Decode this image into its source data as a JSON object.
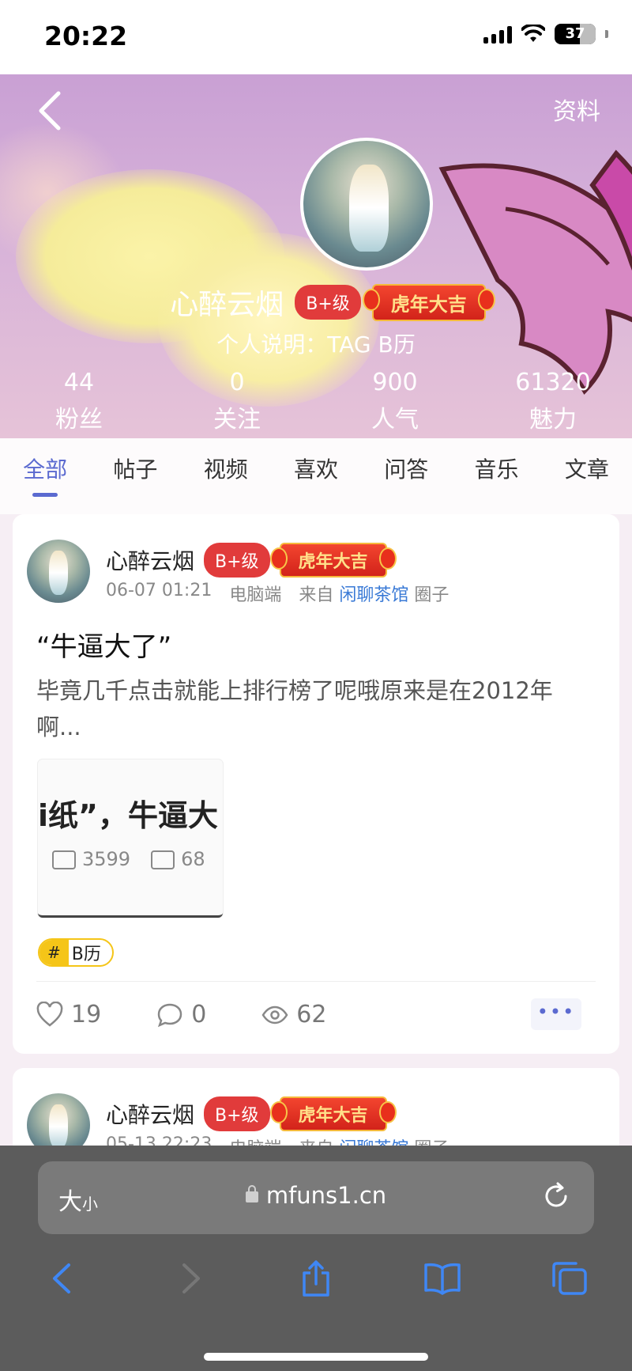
{
  "status_bar": {
    "time": "20:22",
    "battery": "37"
  },
  "header": {
    "profile_link": "资料"
  },
  "profile": {
    "name": "心醉云烟",
    "level": "B+级",
    "festive_badge": "虎年大吉",
    "bio": "个人说明：TAG B历",
    "stats": [
      {
        "value": "44",
        "label": "粉丝"
      },
      {
        "value": "0",
        "label": "关注"
      },
      {
        "value": "900",
        "label": "人气"
      },
      {
        "value": "61320",
        "label": "魅力"
      }
    ]
  },
  "tabs": [
    {
      "label": "全部",
      "active": true
    },
    {
      "label": "帖子"
    },
    {
      "label": "视频"
    },
    {
      "label": "喜欢"
    },
    {
      "label": "问答"
    },
    {
      "label": "音乐"
    },
    {
      "label": "文章"
    }
  ],
  "posts": [
    {
      "author": "心醉云烟",
      "level": "B+级",
      "festive_badge": "虎年大吉",
      "date": "06-07 01:21",
      "device": "电脑端",
      "from_label": "来自",
      "circle": "闲聊茶馆",
      "circle_suffix": "圈子",
      "title": "“牛逼大了”",
      "body": "毕竟几千点击就能上排行榜了呢哦原来是在2012年啊...",
      "thumbnail": {
        "text": "i纸”，牛逼大",
        "plays": "3599",
        "comments": "68"
      },
      "tag": {
        "hash": "#",
        "label": "B历"
      },
      "likes": "19",
      "comments": "0",
      "views": "62",
      "more": "•••"
    },
    {
      "author": "心醉云烟",
      "level": "B+级",
      "festive_badge": "虎年大吉",
      "date": "05-13 22:23",
      "device": "电脑端",
      "from_label": "来自",
      "circle": "闲聊茶馆",
      "circle_suffix": "圈子"
    }
  ],
  "browser": {
    "text_size_big": "大",
    "text_size_small": "小",
    "url": "mfuns1.cn"
  },
  "colors": {
    "accent": "#5b6ad0",
    "badge_red": "#e13b3b",
    "link_blue": "#3a7ad6",
    "tag_yellow": "#f5c518"
  }
}
